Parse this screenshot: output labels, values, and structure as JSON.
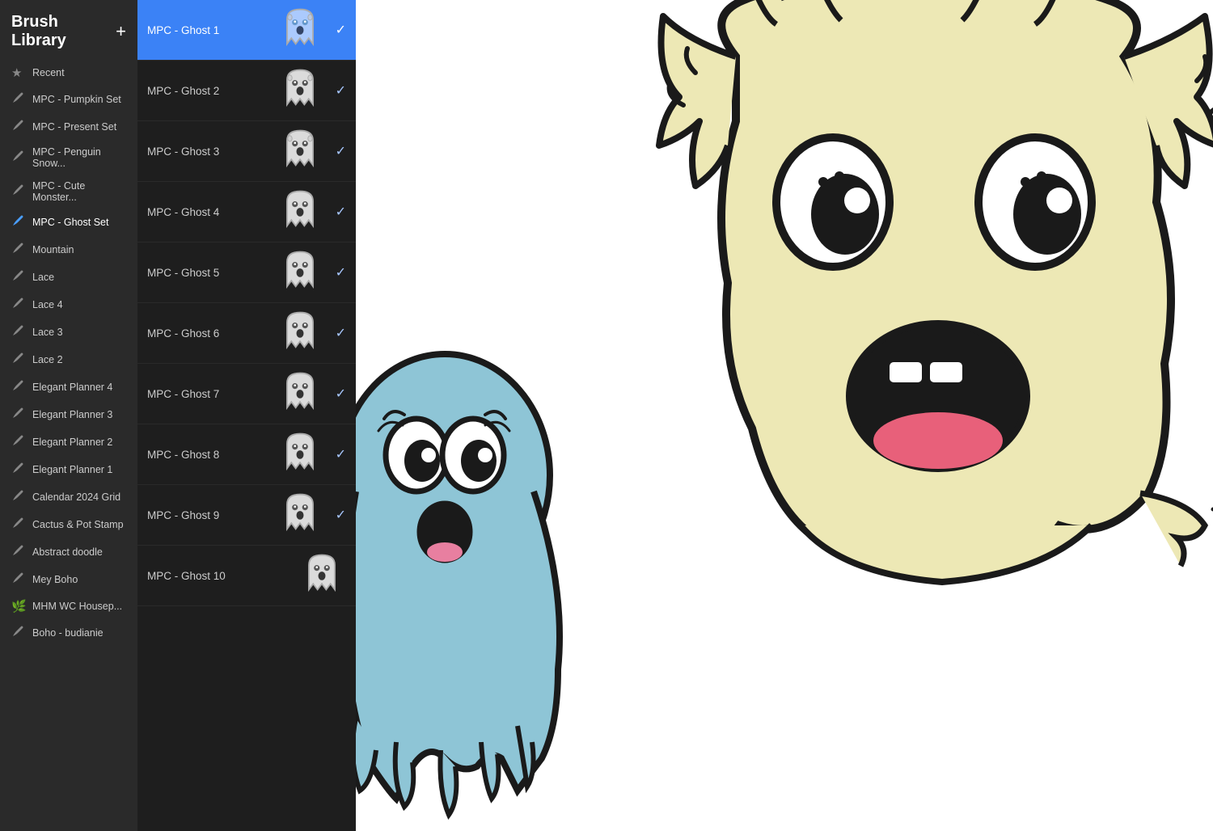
{
  "app": {
    "title": "Brush Library",
    "add_label": "+"
  },
  "sidebar": {
    "items": [
      {
        "id": "recent",
        "label": "Recent",
        "icon": "★",
        "icon_type": "star",
        "active": false
      },
      {
        "id": "mpc-pumpkin",
        "label": "MPC - Pumpkin Set",
        "icon": "~",
        "icon_type": "brush",
        "active": false
      },
      {
        "id": "mpc-present",
        "label": "MPC - Present Set",
        "icon": "~",
        "icon_type": "brush",
        "active": false
      },
      {
        "id": "mpc-penguin",
        "label": "MPC - Penguin Snow...",
        "icon": "~",
        "icon_type": "brush",
        "active": false
      },
      {
        "id": "mpc-cute",
        "label": "MPC - Cute Monster...",
        "icon": "~",
        "icon_type": "brush",
        "active": false
      },
      {
        "id": "mpc-ghost",
        "label": "MPC - Ghost Set",
        "icon": "~",
        "icon_type": "brush-active",
        "active": true
      },
      {
        "id": "mountain",
        "label": "Mountain",
        "icon": "~",
        "icon_type": "brush",
        "active": false
      },
      {
        "id": "lace",
        "label": "Lace",
        "icon": "~",
        "icon_type": "brush",
        "active": false
      },
      {
        "id": "lace4",
        "label": "Lace 4",
        "icon": "~",
        "icon_type": "brush",
        "active": false
      },
      {
        "id": "lace3",
        "label": "Lace 3",
        "icon": "~",
        "icon_type": "brush",
        "active": false
      },
      {
        "id": "lace2",
        "label": "Lace 2",
        "icon": "~",
        "icon_type": "brush",
        "active": false
      },
      {
        "id": "elegant4",
        "label": "Elegant Planner 4",
        "icon": "~",
        "icon_type": "brush",
        "active": false
      },
      {
        "id": "elegant3",
        "label": "Elegant Planner 3",
        "icon": "~",
        "icon_type": "brush",
        "active": false
      },
      {
        "id": "elegant2",
        "label": "Elegant Planner 2",
        "icon": "~",
        "icon_type": "brush",
        "active": false
      },
      {
        "id": "elegant1",
        "label": "Elegant Planner 1",
        "icon": "~",
        "icon_type": "brush",
        "active": false
      },
      {
        "id": "calendar",
        "label": "Calendar 2024 Grid",
        "icon": "~",
        "icon_type": "brush",
        "active": false
      },
      {
        "id": "cactus",
        "label": "Cactus & Pot Stamp",
        "icon": "~",
        "icon_type": "brush",
        "active": false
      },
      {
        "id": "abstract",
        "label": "Abstract doodle",
        "icon": "~",
        "icon_type": "brush",
        "active": false
      },
      {
        "id": "meyboho",
        "label": "Mey Boho",
        "icon": "~",
        "icon_type": "brush",
        "active": false
      },
      {
        "id": "mhm",
        "label": "MHM WC Housep...",
        "icon": "🌿",
        "icon_type": "leaf",
        "active": false
      },
      {
        "id": "boho",
        "label": "Boho - budianie",
        "icon": "~",
        "icon_type": "brush",
        "active": false
      }
    ]
  },
  "brush_panel": {
    "items": [
      {
        "id": "ghost1",
        "name": "MPC - Ghost 1",
        "selected": true,
        "has_check": true
      },
      {
        "id": "ghost2",
        "name": "MPC - Ghost 2",
        "selected": false,
        "has_check": true
      },
      {
        "id": "ghost3",
        "name": "MPC - Ghost 3",
        "selected": false,
        "has_check": true
      },
      {
        "id": "ghost4",
        "name": "MPC - Ghost 4",
        "selected": false,
        "has_check": true
      },
      {
        "id": "ghost5",
        "name": "MPC - Ghost 5",
        "selected": false,
        "has_check": true
      },
      {
        "id": "ghost6",
        "name": "MPC - Ghost 6",
        "selected": false,
        "has_check": true
      },
      {
        "id": "ghost7",
        "name": "MPC - Ghost 7",
        "selected": false,
        "has_check": true
      },
      {
        "id": "ghost8",
        "name": "MPC - Ghost 8",
        "selected": false,
        "has_check": true
      },
      {
        "id": "ghost9",
        "name": "MPC - Ghost 9",
        "selected": false,
        "has_check": true
      },
      {
        "id": "ghost10",
        "name": "MPC - Ghost 10",
        "selected": false,
        "has_check": false
      }
    ]
  },
  "colors": {
    "sidebar_bg": "#2a2a2a",
    "panel_bg": "#1e1e1e",
    "selected_blue": "#3b82f6",
    "canvas_bg": "#ffffff",
    "ghost_blue": "#7bb8d4",
    "ghost_yellow": "#f0e8b0"
  }
}
